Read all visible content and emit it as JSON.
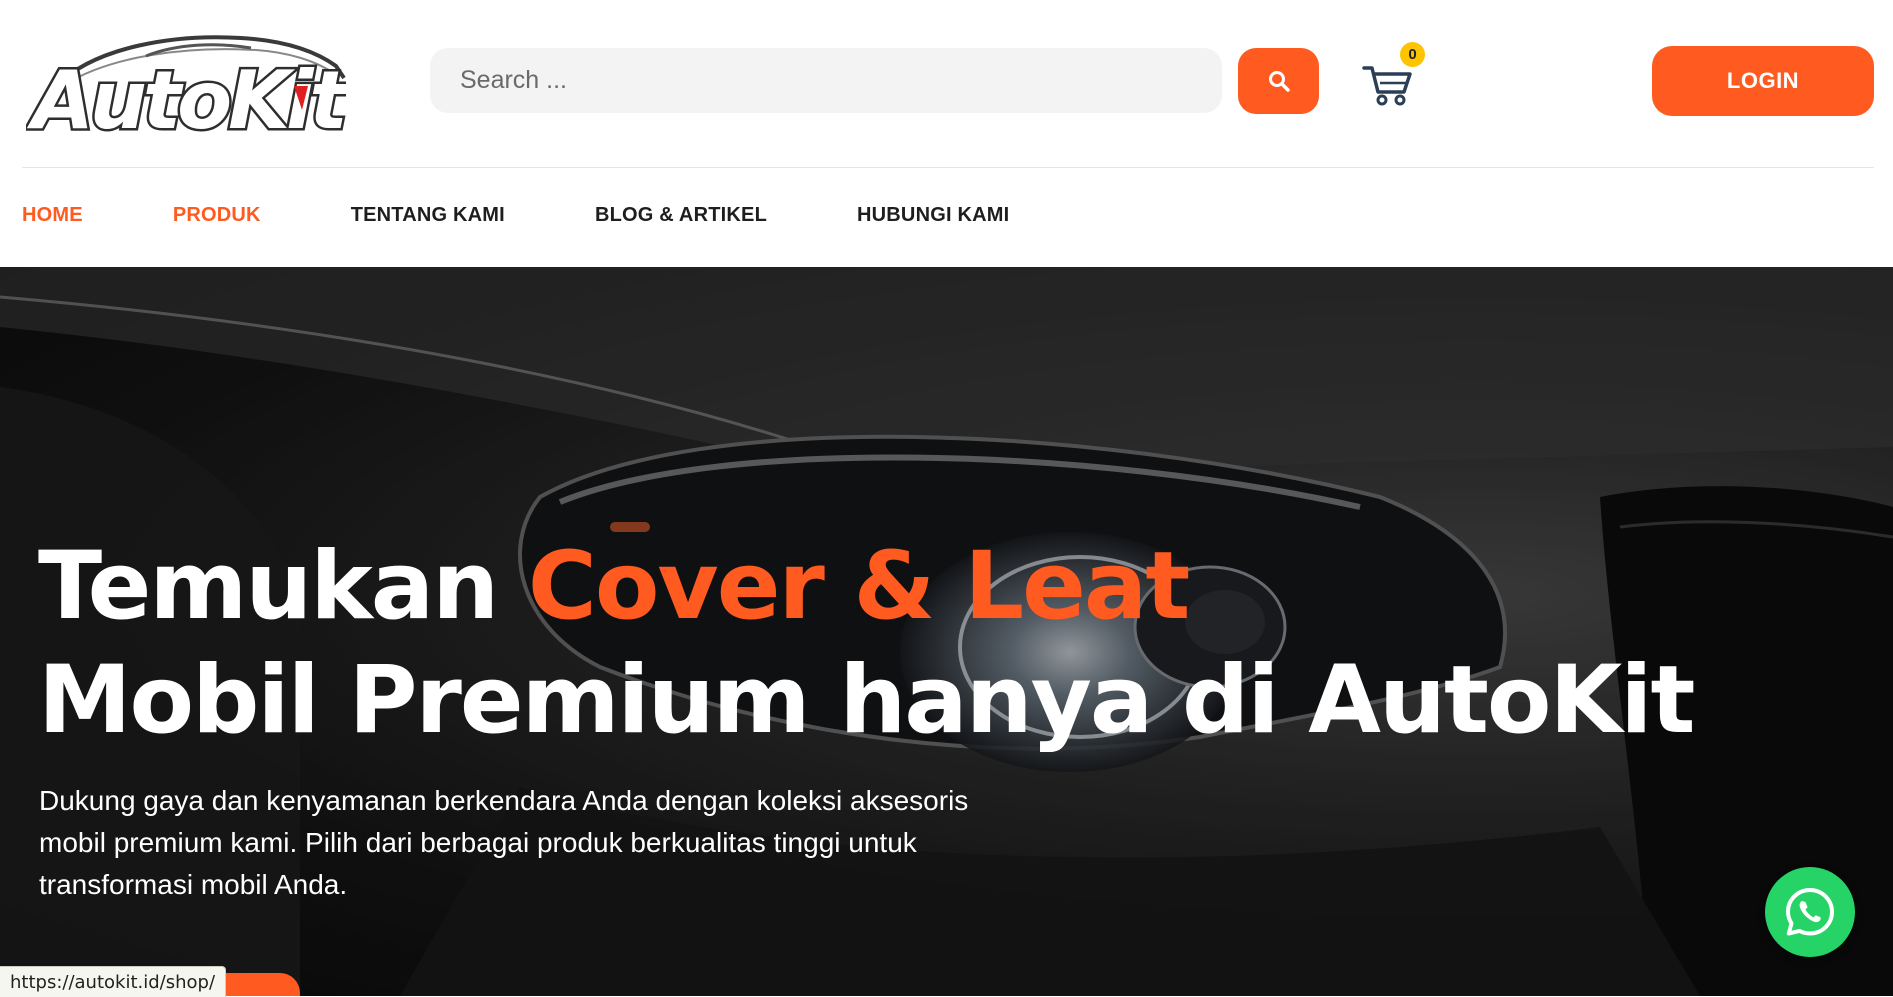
{
  "brand": {
    "logo_text": "AutoKit",
    "accent": "#ff5a1f"
  },
  "search": {
    "placeholder": "Search ...",
    "value": ""
  },
  "cart": {
    "count": "0"
  },
  "header": {
    "login_label": "LOGIN"
  },
  "nav": [
    {
      "label": "HOME",
      "active": true
    },
    {
      "label": "PRODUK",
      "active": true
    },
    {
      "label": "TENTANG KAMI",
      "active": false
    },
    {
      "label": "BLOG & ARTIKEL",
      "active": false
    },
    {
      "label": "HUBUNGI KAMI",
      "active": false
    }
  ],
  "hero": {
    "title_part1": "Temukan ",
    "title_highlight": "Cover & Leat",
    "title_line2": "Mobil Premium hanya di AutoKit",
    "description": "Dukung gaya dan kenyamanan berkendara Anda dengan koleksi aksesoris mobil premium kami. Pilih dari berbagai produk berkualitas tinggi untuk transformasi mobil Anda."
  },
  "status_bar": {
    "url": "https://autokit.id/shop/"
  },
  "icons": {
    "search": "search-icon",
    "cart": "cart-icon",
    "whatsapp": "whatsapp-icon"
  }
}
